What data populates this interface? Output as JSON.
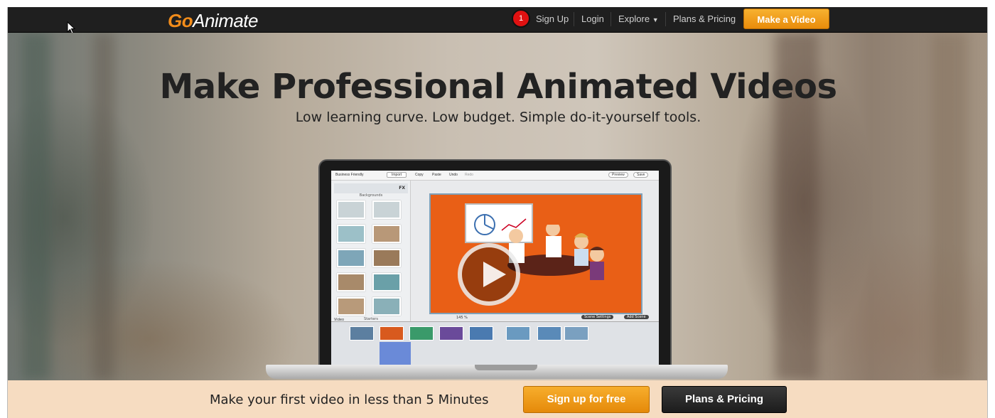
{
  "nav": {
    "logo_go": "Go",
    "logo_animate": "Animate",
    "badge": "1",
    "signup": "Sign Up",
    "login": "Login",
    "explore": "Explore",
    "plans": "Plans & Pricing",
    "make_video": "Make a Video"
  },
  "hero": {
    "title": "Make Professional Animated Videos",
    "subtitle": "Low learning curve. Low budget. Simple do-it-yourself tools."
  },
  "app": {
    "theme_select": "Business Friendly",
    "import": "Import",
    "copy": "Copy",
    "paste": "Paste",
    "undo": "Undo",
    "redo": "Redo",
    "preview": "Preview",
    "save": "Save",
    "fx": "FX",
    "backgrounds": "Backgrounds",
    "starters": "Starters",
    "zoom": "145 %",
    "scene_settings": "Scene Settings",
    "add_scene": "Add Scene",
    "video_label": "Video"
  },
  "bottom": {
    "cta_text": "Make your first video in less than 5 Minutes",
    "signup_free": "Sign up for free",
    "plans": "Plans & Pricing"
  },
  "colors": {
    "accent": "#f28c1a",
    "nav_bg": "#1f1f1f",
    "bar_bg": "#f6dcc1",
    "badge": "#e01111"
  }
}
